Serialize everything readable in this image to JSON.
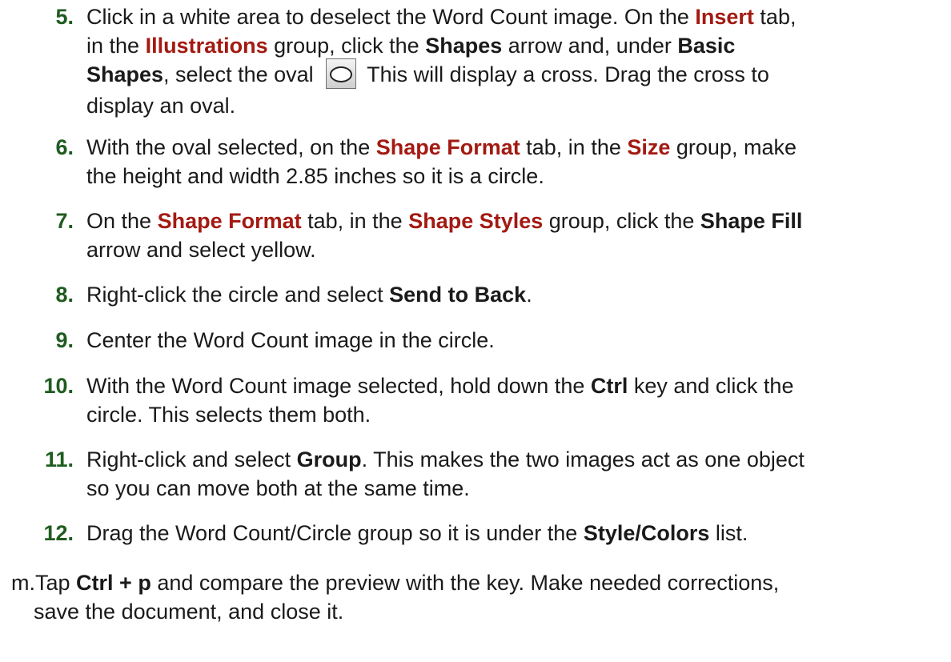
{
  "steps": [
    {
      "number": "5.",
      "lines": [
        [
          "Click in a white area to deselect the Word Count image. On the ",
          "Insert",
          " tab,"
        ],
        [
          "in the ",
          "Illustrations",
          " group, click the ",
          "Shapes",
          " arrow and, under ",
          "Basic"
        ],
        [
          "Shapes",
          ", select the oval ",
          " This will display a cross. Drag the cross to"
        ],
        [
          "display an oval."
        ]
      ]
    },
    {
      "number": "6.",
      "lines": [
        [
          "With the oval selected, on the ",
          "Shape Format",
          " tab, in the ",
          "Size",
          " group, make"
        ],
        [
          "the height and width 2.85 inches so it is a circle."
        ]
      ]
    },
    {
      "number": "7.",
      "lines": [
        [
          "On the ",
          "Shape Format",
          " tab, in the ",
          "Shape Styles",
          " group, click the ",
          "Shape Fill"
        ],
        [
          "arrow and select yellow."
        ]
      ]
    },
    {
      "number": "8.",
      "lines": [
        [
          "Right-click the circle and select ",
          "Send to Back",
          "."
        ]
      ]
    },
    {
      "number": "9.",
      "lines": [
        [
          "Center the Word Count image in the circle."
        ]
      ]
    },
    {
      "number": "10.",
      "lines": [
        [
          "With the Word Count image selected, hold down the ",
          "Ctrl",
          " key and click the"
        ],
        [
          "circle. This selects them both."
        ]
      ]
    },
    {
      "number": "11.",
      "lines": [
        [
          "Right-click and select ",
          "Group",
          ". This makes the two images act as one object"
        ],
        [
          "so you can move both at the same time."
        ]
      ]
    },
    {
      "number": "12.",
      "lines": [
        [
          "Drag the Word Count/Circle group so it is under the ",
          "Style/Colors",
          " list."
        ]
      ]
    }
  ],
  "step_m": {
    "label": "m.",
    "lines": [
      [
        "Tap ",
        "Ctrl + p",
        " and compare the preview with the key. Make needed corrections,"
      ],
      [
        "save the document, and close it."
      ]
    ]
  },
  "colors": {
    "number": "#1f5c1f",
    "keyword": "#a31a12",
    "text": "#1a1a1a"
  },
  "icons": {
    "oval": "oval-shape-icon"
  }
}
